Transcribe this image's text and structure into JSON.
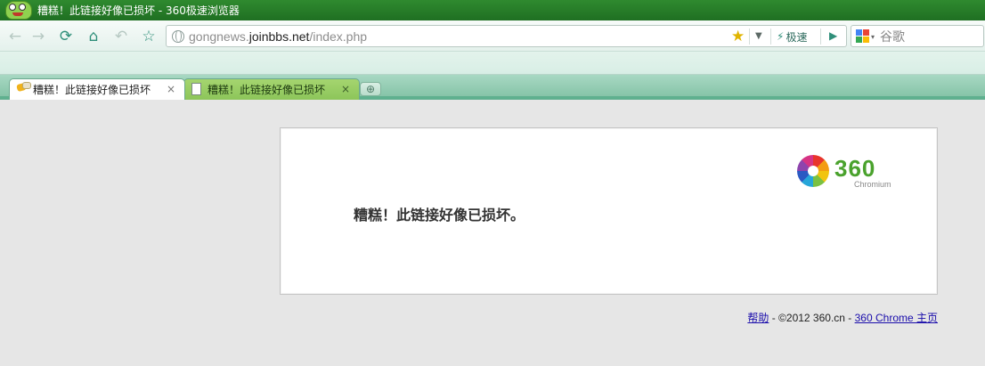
{
  "window": {
    "title": "糟糕！此链接好像已损坏 - 360极速浏览器"
  },
  "toolbar": {
    "url_prefix": "gongnews.",
    "url_domain": "joinbbs.net",
    "url_path": "/index.php",
    "speed_label": "极速",
    "search_placeholder": "谷歌"
  },
  "tabs": [
    {
      "title": "糟糕！此链接好像已损坏",
      "active": true
    },
    {
      "title": "糟糕！此链接好像已损坏",
      "active": false
    }
  ],
  "page": {
    "error_message": "糟糕！此链接好像已损坏。",
    "brand_name": "360",
    "brand_sub": "Chromium",
    "footer": {
      "help": "帮助",
      "sep1": " - ©2012 360.cn - ",
      "home": "360 Chrome 主页"
    }
  },
  "colors": {
    "titlebar": "#2f8a2f",
    "tab_inactive": "#a5d56f",
    "accent": "#2f8f7a",
    "brand_green": "#4aa22d"
  }
}
